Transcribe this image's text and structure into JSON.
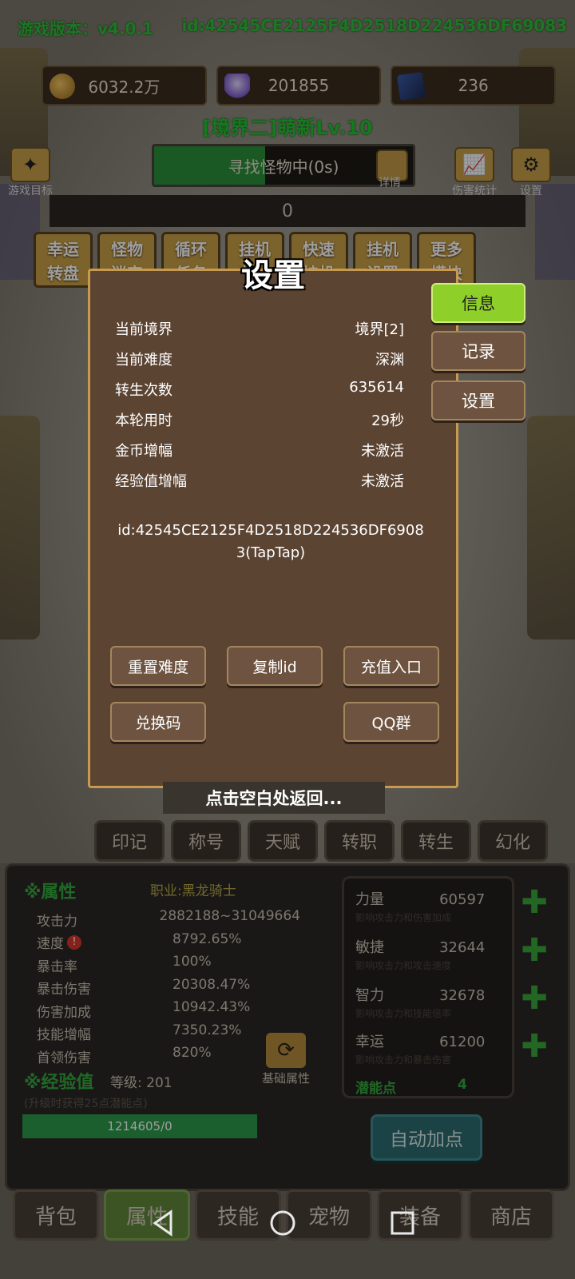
{
  "header": {
    "version": "游戏版本：v4.0.1",
    "player_id": "id:42545CE2125F4D2518D224536DF69083"
  },
  "currencies": [
    {
      "icon": "coin-icon",
      "value": "6032.2万"
    },
    {
      "icon": "crystal-icon",
      "value": "201855"
    },
    {
      "icon": "card-icon",
      "value": "236"
    }
  ],
  "realm_title": "[境界二]萌新Lv.10",
  "search": {
    "text": "寻找怪物中(0s)",
    "progress": 0.43,
    "details_label": "详情"
  },
  "side_buttons": {
    "goal": "游戏目标",
    "damage_stats": "伤害统计",
    "settings": "设置"
  },
  "score": "0",
  "features": [
    "幸运\n转盘",
    "怪物\n迷宫",
    "循环\n任务",
    "挂机\n收益",
    "快速\n挂机",
    "挂机\n设置",
    "更多\n模块"
  ],
  "modal": {
    "title": "设置",
    "rows": [
      {
        "label": "当前境界",
        "value": "境界[2]"
      },
      {
        "label": "当前难度",
        "value": "深渊"
      },
      {
        "label": "转生次数",
        "value": "635614"
      },
      {
        "label": "本轮用时",
        "value": "29秒"
      },
      {
        "label": "金币增幅",
        "value": "未激活"
      },
      {
        "label": "经验值增幅",
        "value": "未激活"
      }
    ],
    "id_text": "id:42545CE2125F4D2518D224536DF69083(TapTap)",
    "buttons": {
      "reset": "重置难度",
      "copy": "复制id",
      "recharge": "充值入口",
      "redeem": "兑换码",
      "qq": "QQ群"
    },
    "tabs": {
      "info": "信息",
      "record": "记录",
      "settings": "设置"
    }
  },
  "back_hint": "点击空白处返回...",
  "attr_tabs": [
    "印记",
    "称号",
    "天赋",
    "转职",
    "转生",
    "幻化"
  ],
  "attributes": {
    "heading": "※属性",
    "job": "职业:黑龙骑士",
    "rows": [
      {
        "k": "攻击力",
        "v": "2882188~31049664"
      },
      {
        "k": "速度",
        "v": "8792.65%"
      },
      {
        "k": "暴击率",
        "v": "100%"
      },
      {
        "k": "暴击伤害",
        "v": "20308.47%"
      },
      {
        "k": "伤害加成",
        "v": "10942.43%"
      },
      {
        "k": "技能增幅",
        "v": "7350.23%"
      },
      {
        "k": "首领伤害",
        "v": "820%"
      }
    ],
    "warn_mark": "!"
  },
  "experience": {
    "heading": "※经验值",
    "level": "等级: 201",
    "note": "(升级时获得25点潜能点)",
    "bar": "1214605/0"
  },
  "swap_label": "基础属性",
  "potential": {
    "rows": [
      {
        "name": "力量",
        "value": "60597",
        "desc": "影响攻击力和伤害加成"
      },
      {
        "name": "敏捷",
        "value": "32644",
        "desc": "影响攻击力和攻击速度"
      },
      {
        "name": "智力",
        "value": "32678",
        "desc": "影响攻击力和技能倍率"
      },
      {
        "name": "幸运",
        "value": "61200",
        "desc": "影响攻击力和暴击伤害"
      }
    ],
    "points_label": "潜能点",
    "points": "4",
    "plus_symbol": "✚"
  },
  "auto_add": "自动加点",
  "bottom_nav": [
    "背包",
    "属性",
    "技能",
    "宠物",
    "装备",
    "商店"
  ],
  "colors": {
    "accent_green": "#33a83e",
    "active_tab": "#8fcf2a",
    "modal_bg": "#5c4433"
  }
}
